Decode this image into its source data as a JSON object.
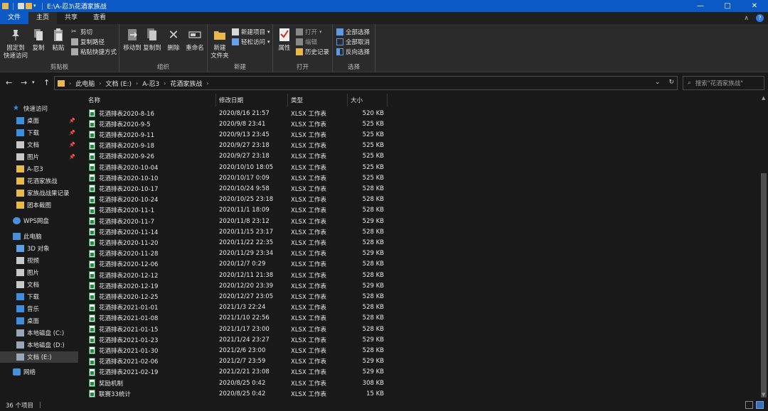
{
  "window": {
    "title": "E:\\A-忍3\\花酒家族战",
    "min": "—",
    "max": "□",
    "close": "✕"
  },
  "tabs": {
    "file": "文件",
    "home": "主页",
    "share": "共享",
    "view": "查看"
  },
  "ribbon": {
    "clipboard": {
      "label": "剪贴板",
      "pin": "固定到\n快速访问",
      "copy": "复制",
      "paste": "粘贴",
      "cut": "剪切",
      "copy_path": "复制路径",
      "paste_shortcut": "粘贴快捷方式"
    },
    "organize": {
      "label": "组织",
      "move_to": "移动到",
      "copy_to": "复制到",
      "delete": "删除",
      "rename": "重命名"
    },
    "new": {
      "label": "新建",
      "new_folder": "新建\n文件夹",
      "new_item": "新建项目",
      "easy_access": "轻松访问"
    },
    "open": {
      "label": "打开",
      "properties": "属性",
      "open": "打开",
      "edit": "编辑",
      "history": "历史记录"
    },
    "select": {
      "label": "选择",
      "select_all": "全部选择",
      "select_none": "全部取消",
      "invert": "反向选择"
    }
  },
  "address": {
    "crumbs": [
      "此电脑",
      "文档 (E:)",
      "A-忍3",
      "花酒家族战"
    ],
    "search_placeholder": "搜索\"花酒家族战\""
  },
  "nav": {
    "quick_access": "快速访问",
    "qa_items": [
      {
        "label": "桌面",
        "color": "#3d8ee0",
        "pinned": true
      },
      {
        "label": "下载",
        "color": "#3d8ee0",
        "pinned": true
      },
      {
        "label": "文档",
        "color": "#c8c8c8",
        "pinned": true
      },
      {
        "label": "图片",
        "color": "#c8c8c8",
        "pinned": true
      },
      {
        "label": "A-忍3",
        "color": "#e8b84a",
        "pinned": false
      },
      {
        "label": "花酒家族战",
        "color": "#e8b84a",
        "pinned": false
      },
      {
        "label": "家族战战果记录",
        "color": "#e8b84a",
        "pinned": false
      },
      {
        "label": "团本截图",
        "color": "#e8b84a",
        "pinned": false
      }
    ],
    "wps": "WPS网盘",
    "this_pc": "此电脑",
    "pc_items": [
      {
        "label": "3D 对象",
        "color": "#5aa0e6"
      },
      {
        "label": "视频",
        "color": "#c8c8c8"
      },
      {
        "label": "图片",
        "color": "#c8c8c8"
      },
      {
        "label": "文档",
        "color": "#c8c8c8"
      },
      {
        "label": "下载",
        "color": "#3d8ee0"
      },
      {
        "label": "音乐",
        "color": "#3d8ee0"
      },
      {
        "label": "桌面",
        "color": "#3d8ee0"
      },
      {
        "label": "本地磁盘 (C:)",
        "color": "#9aa6b8"
      },
      {
        "label": "本地磁盘 (D:)",
        "color": "#9aa6b8"
      },
      {
        "label": "文档 (E:)",
        "color": "#9aa6b8"
      }
    ],
    "network": "网络"
  },
  "columns": {
    "name": "名称",
    "modified": "修改日期",
    "type": "类型",
    "size": "大小"
  },
  "files": [
    {
      "name": "花酒排表2020-8-16",
      "modified": "2020/8/16 21:57",
      "type": "XLSX 工作表",
      "size": "520 KB"
    },
    {
      "name": "花酒排表2020-9-5",
      "modified": "2020/9/8 23:41",
      "type": "XLSX 工作表",
      "size": "525 KB"
    },
    {
      "name": "花酒排表2020-9-11",
      "modified": "2020/9/13 23:45",
      "type": "XLSX 工作表",
      "size": "525 KB"
    },
    {
      "name": "花酒排表2020-9-18",
      "modified": "2020/9/27 23:18",
      "type": "XLSX 工作表",
      "size": "525 KB"
    },
    {
      "name": "花酒排表2020-9-26",
      "modified": "2020/9/27 23:18",
      "type": "XLSX 工作表",
      "size": "525 KB"
    },
    {
      "name": "花酒排表2020-10-04",
      "modified": "2020/10/10 18:05",
      "type": "XLSX 工作表",
      "size": "525 KB"
    },
    {
      "name": "花酒排表2020-10-10",
      "modified": "2020/10/17 0:09",
      "type": "XLSX 工作表",
      "size": "525 KB"
    },
    {
      "name": "花酒排表2020-10-17",
      "modified": "2020/10/24 9:58",
      "type": "XLSX 工作表",
      "size": "528 KB"
    },
    {
      "name": "花酒排表2020-10-24",
      "modified": "2020/10/25 23:18",
      "type": "XLSX 工作表",
      "size": "528 KB"
    },
    {
      "name": "花酒排表2020-11-1",
      "modified": "2020/11/1 18:09",
      "type": "XLSX 工作表",
      "size": "528 KB"
    },
    {
      "name": "花酒排表2020-11-7",
      "modified": "2020/11/8 23:12",
      "type": "XLSX 工作表",
      "size": "529 KB"
    },
    {
      "name": "花酒排表2020-11-14",
      "modified": "2020/11/15 23:17",
      "type": "XLSX 工作表",
      "size": "528 KB"
    },
    {
      "name": "花酒排表2020-11-20",
      "modified": "2020/11/22 22:35",
      "type": "XLSX 工作表",
      "size": "528 KB"
    },
    {
      "name": "花酒排表2020-11-28",
      "modified": "2020/11/29 23:34",
      "type": "XLSX 工作表",
      "size": "529 KB"
    },
    {
      "name": "花酒排表2020-12-06",
      "modified": "2020/12/7 0:29",
      "type": "XLSX 工作表",
      "size": "528 KB"
    },
    {
      "name": "花酒排表2020-12-12",
      "modified": "2020/12/11 21:38",
      "type": "XLSX 工作表",
      "size": "528 KB"
    },
    {
      "name": "花酒排表2020-12-19",
      "modified": "2020/12/20 23:39",
      "type": "XLSX 工作表",
      "size": "529 KB"
    },
    {
      "name": "花酒排表2020-12-25",
      "modified": "2020/12/27 23:05",
      "type": "XLSX 工作表",
      "size": "528 KB"
    },
    {
      "name": "花酒排表2021-01-01",
      "modified": "2021/1/3 22:24",
      "type": "XLSX 工作表",
      "size": "528 KB"
    },
    {
      "name": "花酒排表2021-01-08",
      "modified": "2021/1/10 22:56",
      "type": "XLSX 工作表",
      "size": "528 KB"
    },
    {
      "name": "花酒排表2021-01-15",
      "modified": "2021/1/17 23:00",
      "type": "XLSX 工作表",
      "size": "528 KB"
    },
    {
      "name": "花酒排表2021-01-23",
      "modified": "2021/1/24 23:27",
      "type": "XLSX 工作表",
      "size": "529 KB"
    },
    {
      "name": "花酒排表2021-01-30",
      "modified": "2021/2/6 23:00",
      "type": "XLSX 工作表",
      "size": "528 KB"
    },
    {
      "name": "花酒排表2021-02-06",
      "modified": "2021/2/7 23:59",
      "type": "XLSX 工作表",
      "size": "529 KB"
    },
    {
      "name": "花酒排表2021-02-19",
      "modified": "2021/2/21 23:08",
      "type": "XLSX 工作表",
      "size": "529 KB"
    },
    {
      "name": "奖励机制",
      "modified": "2020/8/25 0:42",
      "type": "XLSX 工作表",
      "size": "308 KB"
    },
    {
      "name": "联赛33统计",
      "modified": "2020/8/25 0:42",
      "type": "XLSX 工作表",
      "size": "15 KB"
    }
  ],
  "status": {
    "count": "36 个项目"
  }
}
